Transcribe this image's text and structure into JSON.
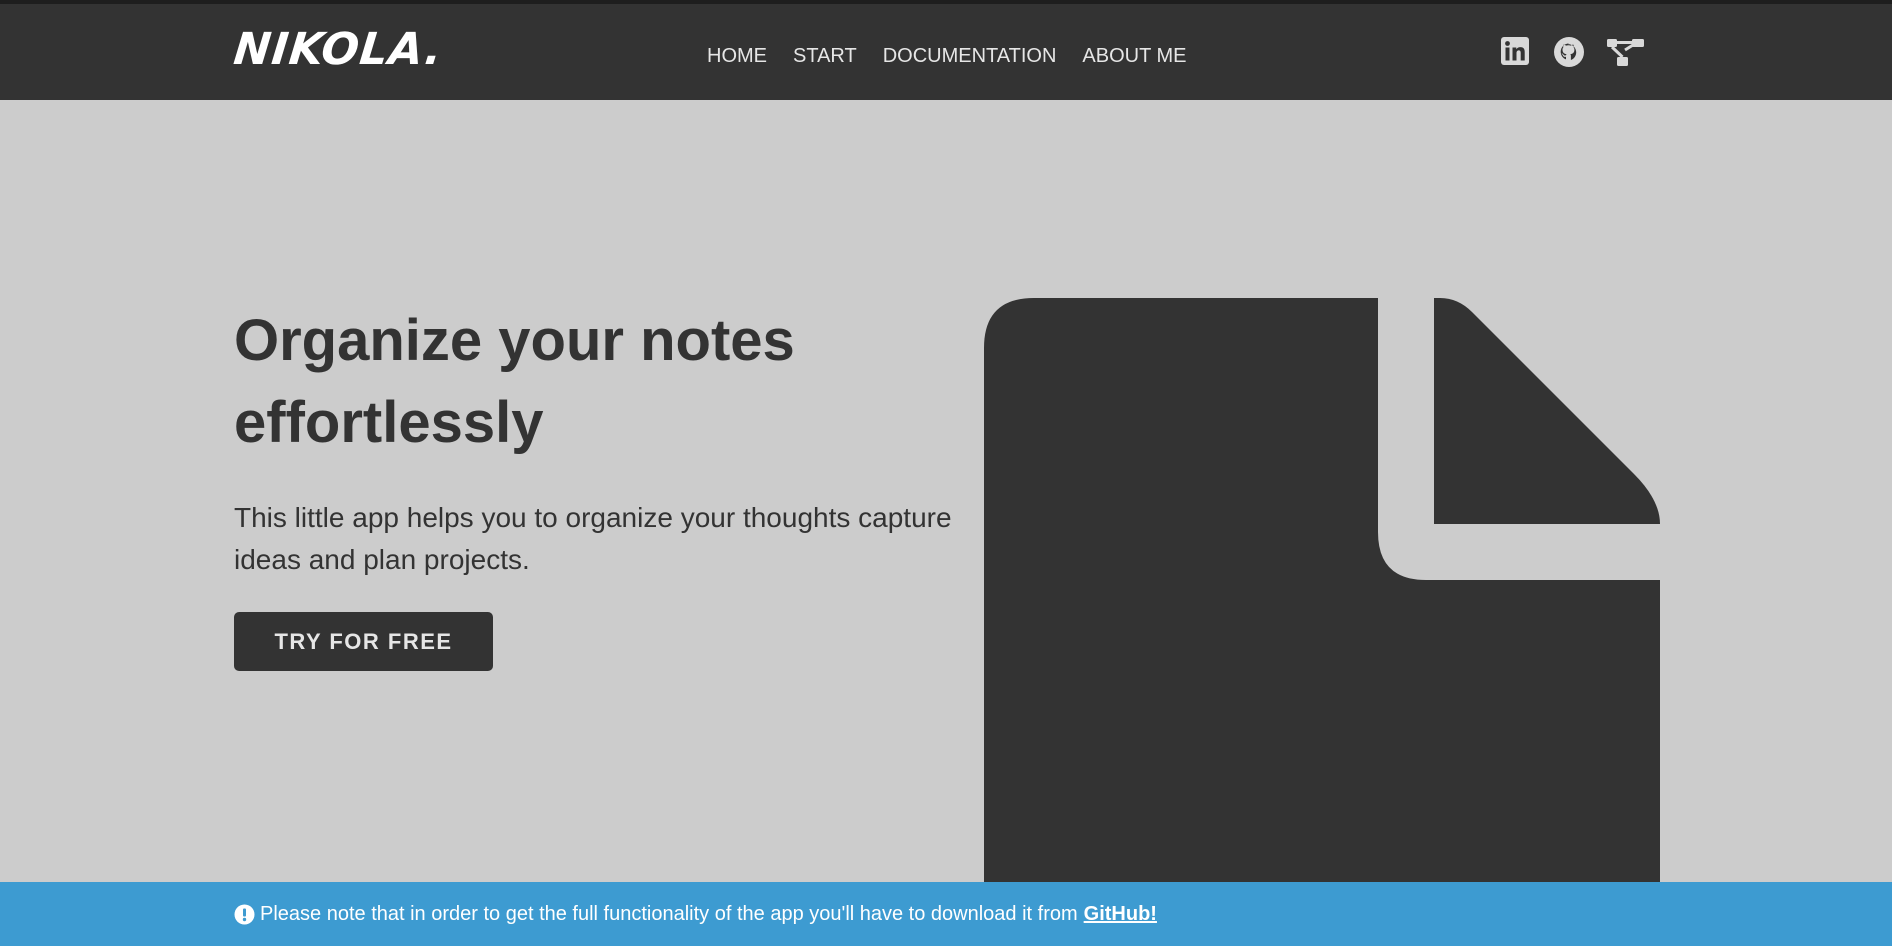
{
  "brand": {
    "name": "NIKOLA."
  },
  "nav": {
    "items": [
      {
        "label": "HOME"
      },
      {
        "label": "START"
      },
      {
        "label": "DOCUMENTATION"
      },
      {
        "label": "ABOUT ME"
      }
    ]
  },
  "social": {
    "icons": [
      "linkedin-icon",
      "github-icon",
      "sitemap-icon"
    ]
  },
  "hero": {
    "title": "Organize your notes effortlessly",
    "description": "This little app helps you to organize your thoughts capture ideas and plan projects.",
    "cta_label": "TRY FOR FREE",
    "graphic_icon": "file-icon"
  },
  "notice": {
    "text": "Please note that in order to get the full functionality of the app you'll have to download it from",
    "link_label": "GitHub!",
    "icon": "exclamation-circle-icon"
  },
  "colors": {
    "nav_background": "#333333",
    "page_background": "#cccccc",
    "primary_dark": "#333333",
    "nav_text": "#e6e6e6",
    "notice_background": "#3d9bd1"
  }
}
